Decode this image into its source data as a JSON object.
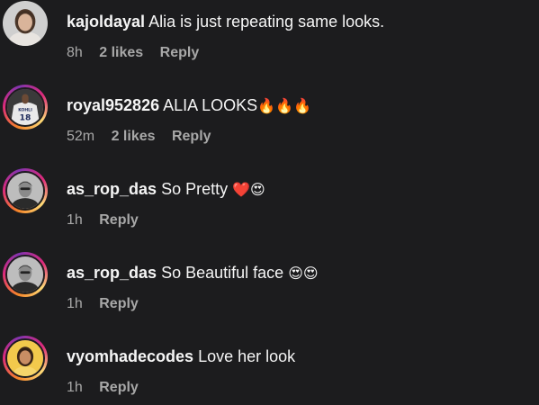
{
  "comments": [
    {
      "username": "kajoldayal",
      "text": "Alia is just repeating same looks.",
      "emoji": "",
      "time": "8h",
      "likes": "2 likes",
      "reply": "Reply",
      "avatar_icon": "woman-portrait",
      "story_ring": false
    },
    {
      "username": "royal952826",
      "text": "ALIA LOOKS",
      "emoji": "🔥🔥🔥",
      "time": "52m",
      "likes": "2 likes",
      "reply": "Reply",
      "avatar_icon": "cricket-jersey-18",
      "story_ring": true,
      "jersey_name": "KOHLI",
      "jersey_number": "18"
    },
    {
      "username": "as_rop_das",
      "text": "So Pretty",
      "emoji": "❤️😍",
      "time": "1h",
      "likes": "",
      "reply": "Reply",
      "avatar_icon": "man-portrait-bw",
      "story_ring": true
    },
    {
      "username": "as_rop_das",
      "text": "So Beautiful face",
      "emoji": "😍😍",
      "time": "1h",
      "likes": "",
      "reply": "Reply",
      "avatar_icon": "man-portrait-bw",
      "story_ring": true
    },
    {
      "username": "vyomhadecodes",
      "text": "Love her look",
      "emoji": "",
      "time": "1h",
      "likes": "",
      "reply": "Reply",
      "avatar_icon": "woman-portrait-yellow",
      "story_ring": true
    }
  ],
  "colors": {
    "background": "#1c1c1e",
    "text": "#f5f5f5",
    "meta": "#a8a8a8"
  }
}
